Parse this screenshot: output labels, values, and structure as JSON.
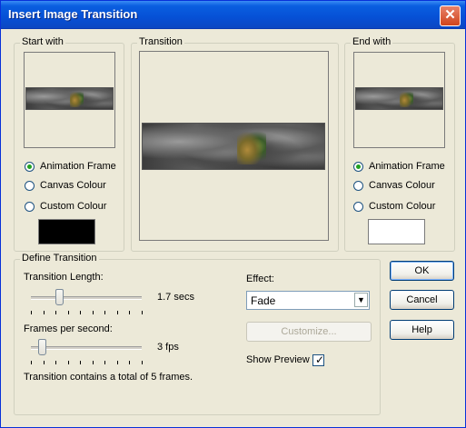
{
  "window": {
    "title": "Insert Image Transition",
    "close_glyph": "✕"
  },
  "start_with": {
    "title": "Start with",
    "options": [
      "Animation Frame",
      "Canvas Colour",
      "Custom Colour"
    ],
    "selected": "Animation Frame",
    "swatch_color": "#000000"
  },
  "transition": {
    "title": "Transition"
  },
  "end_with": {
    "title": "End with",
    "options": [
      "Animation Frame",
      "Canvas Colour",
      "Custom Colour"
    ],
    "selected": "Animation Frame",
    "swatch_color": "#ffffff"
  },
  "define": {
    "title": "Define Transition",
    "length_label": "Transition Length:",
    "length_value": "1.7 secs",
    "length_level": 0.25,
    "fps_label": "Frames per second:",
    "fps_value": "3 fps",
    "fps_level": 0.1,
    "summary": "Transition contains a total of 5 frames.",
    "effect_label": "Effect:",
    "effect_value": "Fade",
    "customize_label": "Customize...",
    "show_preview_label": "Show Preview",
    "show_preview_checked": true
  },
  "buttons": {
    "ok": "OK",
    "cancel": "Cancel",
    "help": "Help"
  },
  "icons": {
    "close": "close-icon",
    "dropdown": "chevron-down-icon",
    "check": "check-icon"
  }
}
